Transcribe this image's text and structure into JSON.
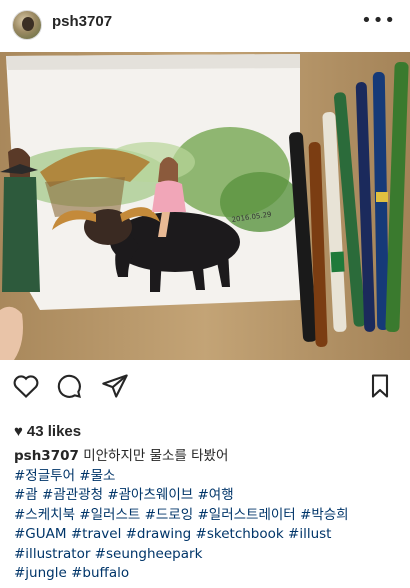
{
  "post": {
    "username": "psh3707",
    "more_icon": "more-dots-icon",
    "likes_text": "43 likes"
  },
  "caption": {
    "username": "psh3707",
    "text": "미안하지만 물소를 타봤어",
    "lines": [
      [
        "#정글투어",
        "#물소"
      ],
      [
        "#괌",
        "#괌관광청",
        "#괌아츠웨이브",
        "#여행"
      ],
      [
        "#스케치북",
        "#일러스트",
        "#드로잉",
        "#일러스트레이터",
        "#박승희"
      ],
      [
        "#GUAM",
        "#travel",
        "#drawing",
        "#sketchbook",
        "#illust"
      ],
      [
        "#illustrator",
        "#seungheepark"
      ],
      [
        "#jungle",
        "#buffalo"
      ]
    ]
  },
  "actions": {
    "like_icon": "heart-icon",
    "comment_icon": "comment-icon",
    "share_icon": "share-icon",
    "save_icon": "bookmark-icon"
  },
  "colors": {
    "text": "#262626",
    "hashtag": "#003569",
    "background": "#ffffff"
  }
}
